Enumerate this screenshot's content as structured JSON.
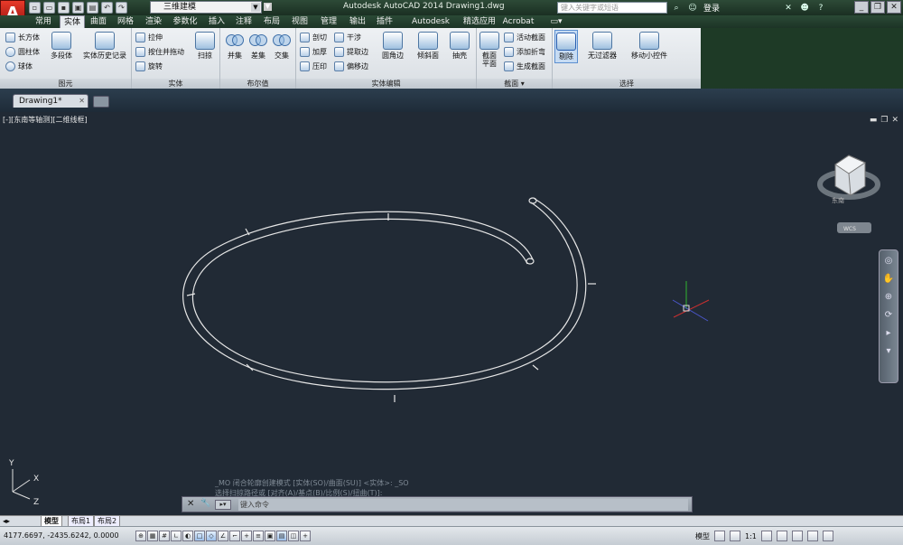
{
  "app": {
    "logo_letter": "A",
    "workspace": "三维建模",
    "window_title": "Autodesk AutoCAD 2014    Drawing1.dwg",
    "search_placeholder": "键入关键字或短语",
    "login": "登录"
  },
  "menu_tabs": [
    "常用",
    "实体",
    "曲面",
    "网格",
    "渲染",
    "参数化",
    "插入",
    "注释",
    "布局",
    "视图",
    "管理",
    "输出",
    "插件",
    "Autodesk 360",
    "精选应用",
    "Acrobat"
  ],
  "active_menu_tab": "实体",
  "ribbon": {
    "primitive": {
      "title": "图元",
      "items": [
        "长方体",
        "圆柱体",
        "球体"
      ],
      "polysolid": "多段体",
      "history": "实体历史记录"
    },
    "solid": {
      "title": "实体",
      "items": [
        "拉伸",
        "按住并拖动",
        "旋转"
      ],
      "sweep": "扫掠"
    },
    "boolean": {
      "title": "布尔值",
      "union": "并集",
      "subtract": "差集",
      "intersect": "交集"
    },
    "solid_edit": {
      "title": "实体编辑",
      "col1": [
        "剖切",
        "加厚",
        "压印"
      ],
      "col2": [
        "干涉",
        "提取边",
        "偏移边"
      ],
      "fillet": "圆角边",
      "taper": "倾斜面",
      "shell": "抽壳"
    },
    "section": {
      "title": "截面",
      "plane": "截面平面",
      "items": [
        "活动截面",
        "添加折弯",
        "生成截面"
      ]
    },
    "selection": {
      "title": "选择",
      "cull": "剔除",
      "filter": "无过滤器",
      "gizmo": "移动小控件"
    }
  },
  "doc_tab": "Drawing1*",
  "viewport_label": "[-][东南等轴测][二维线框]",
  "viewcube_label": "东南",
  "viewcube_wcs": "WCS",
  "ucs": {
    "y": "Y",
    "x": "X",
    "z": "Z"
  },
  "command_history": [
    "_MO  闭合轮廓创建模式 [实体(SO)/曲面(SU)] <实体>: _SO",
    "选择扫掠路径或 [对齐(A)/基点(B)/比例(S)/扭曲(T)]:"
  ],
  "command_placeholder": "键入命令",
  "layout_tabs": [
    "模型",
    "布局1",
    "布局2"
  ],
  "status": {
    "coords": "4177.6697, -2435.6242, 0.0000",
    "model": "模型",
    "scale": "1:1"
  },
  "colors": {
    "viewport_bg": "#212a35",
    "titlebar": "#1a2f22",
    "ribbon": "#e6eaee",
    "accent": "#c0282a"
  }
}
